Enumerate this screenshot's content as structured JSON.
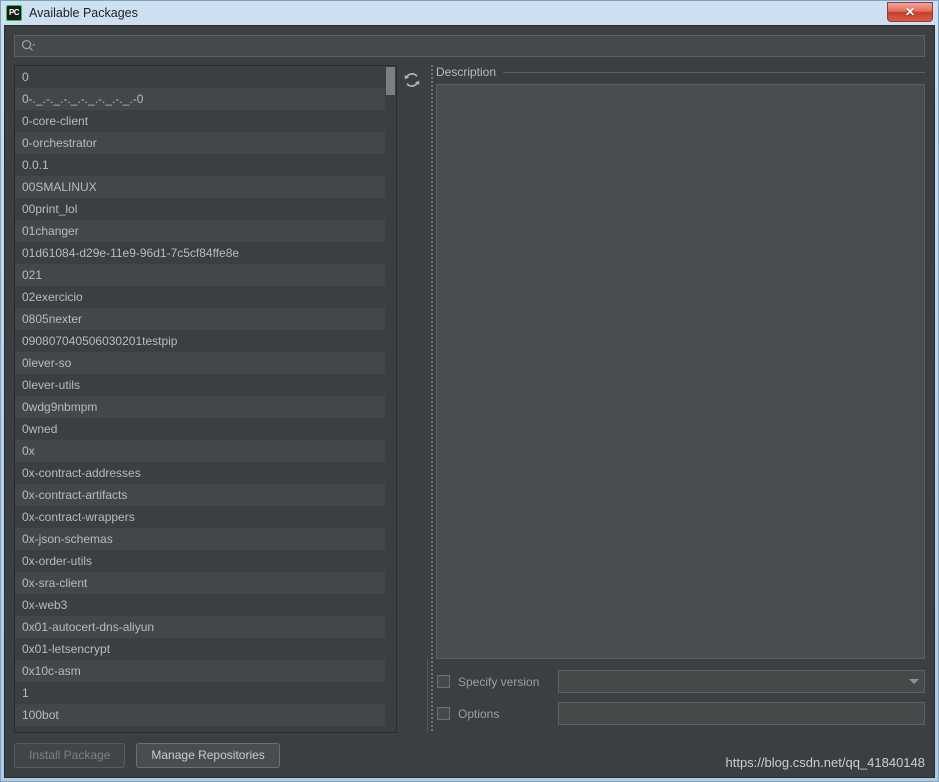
{
  "window": {
    "title": "Available Packages",
    "app_icon": "pycharm-pc-icon",
    "app_icon_text": "PC",
    "close_label": "✕",
    "frame_color": "#b9d2e8",
    "body_color": "#3c3f41"
  },
  "search": {
    "icon": "search-icon",
    "value": "",
    "placeholder": ""
  },
  "packages": {
    "refresh_icon": "refresh-icon",
    "items": [
      "0",
      "0-._.-._.-._.-._.-._.-._.-0",
      "0-core-client",
      "0-orchestrator",
      "0.0.1",
      "00SMALINUX",
      "00print_lol",
      "01changer",
      "01d61084-d29e-11e9-96d1-7c5cf84ffe8e",
      "021",
      "02exercicio",
      "0805nexter",
      "090807040506030201testpip",
      "0lever-so",
      "0lever-utils",
      "0wdg9nbmpm",
      "0wned",
      "0x",
      "0x-contract-addresses",
      "0x-contract-artifacts",
      "0x-contract-wrappers",
      "0x-json-schemas",
      "0x-order-utils",
      "0x-sra-client",
      "0x-web3",
      "0x01-autocert-dns-aliyun",
      "0x01-letsencrypt",
      "0x10c-asm",
      "1",
      "100bot"
    ]
  },
  "description": {
    "legend": "Description",
    "content": ""
  },
  "options": {
    "specify_version": {
      "label": "Specify version",
      "checked": false,
      "value": "",
      "control": "combo-box"
    },
    "options_field": {
      "label": "Options",
      "checked": false,
      "value": "",
      "control": "text-field"
    }
  },
  "footer": {
    "install_label": "Install Package",
    "install_enabled": false,
    "manage_label": "Manage Repositories",
    "watermark": "https://blog.csdn.net/qq_41840148"
  }
}
